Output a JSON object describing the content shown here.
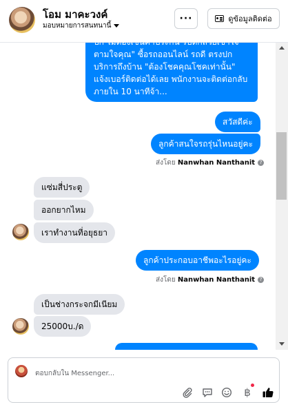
{
  "header": {
    "contact_name": "โอม มาคะวงค์",
    "assign_label": "มอบหมายการสนทนานี้",
    "more_label": "···",
    "info_label": "ดูข้อมูลติดต่อ"
  },
  "messages": {
    "out_long": "ปก ไม่ต้องเซ็นค้ำประกัน รับดีกล้วยเข้าใจ ตามใจคุณ\" ซื้อรถออนไลน์ รถดี ตรงปก บริการถึงบ้าน \"ต้องโชคคุณโชคเท่านั้น\" แจ้งเบอร์ติดต่อได้เลย พนักงานจะติดต่อกลับภายใน 10 นาทีจ้า...",
    "out_greeting": "สวัสดีค่ะ",
    "out_question_model": "ลูกค้าสนใจรถรุ่นไหนอยู่คะ",
    "sent_by_prefix": "ส่งโดย",
    "sent_by_name": "Nanwhan Nanthanit",
    "in_1": "แซ่มสี่ประตู",
    "in_2": "ออกยากไหม",
    "in_3": "เราทำงานที่อยุธยา",
    "out_question_job": "ลูกค้าประกอบอาชีพอะไรอยู่คะ",
    "in_4": "เป็นช่างกระจกมีเนียม",
    "in_5": "25000บ./ด"
  },
  "composer": {
    "placeholder": "ตอบกลับใน Messenger..."
  },
  "icons": {
    "attach": "paperclip-icon",
    "saved_replies": "chat-bubble-icon",
    "emoji": "smiley-icon",
    "payment": "baht-icon",
    "like": "thumbs-up-icon"
  },
  "colors": {
    "outgoing_bubble": "#0084ff",
    "incoming_bubble": "#e4e6eb",
    "notification_dot": "#f02849"
  }
}
